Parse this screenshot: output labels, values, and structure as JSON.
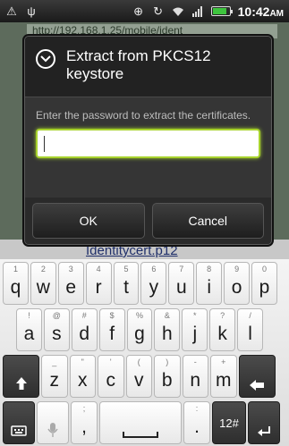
{
  "status_bar": {
    "time": "10:42",
    "ampm": "AM",
    "icons": [
      "warning-icon",
      "usb-icon",
      "gps-icon",
      "sync-icon",
      "wifi-icon",
      "signal-icon",
      "battery-icon"
    ],
    "battery_level": 0.85
  },
  "background": {
    "url": "http://192.168.1.25/mobile/ident",
    "file_link": "Identitycert.p12"
  },
  "dialog": {
    "title": "Extract from PKCS12 keystore",
    "message": "Enter the password to extract the certificates.",
    "password_value": "",
    "ok_label": "OK",
    "cancel_label": "Cancel"
  },
  "keyboard": {
    "row1": [
      {
        "key": "q",
        "sub": "1"
      },
      {
        "key": "w",
        "sub": "2"
      },
      {
        "key": "e",
        "sub": "3"
      },
      {
        "key": "r",
        "sub": "4"
      },
      {
        "key": "t",
        "sub": "5"
      },
      {
        "key": "y",
        "sub": "6"
      },
      {
        "key": "u",
        "sub": "7"
      },
      {
        "key": "i",
        "sub": "8"
      },
      {
        "key": "o",
        "sub": "9"
      },
      {
        "key": "p",
        "sub": "0"
      }
    ],
    "row2": [
      {
        "key": "a",
        "sub": "!"
      },
      {
        "key": "s",
        "sub": "@"
      },
      {
        "key": "d",
        "sub": "#"
      },
      {
        "key": "f",
        "sub": "$"
      },
      {
        "key": "g",
        "sub": "%"
      },
      {
        "key": "h",
        "sub": "&"
      },
      {
        "key": "j",
        "sub": "*"
      },
      {
        "key": "k",
        "sub": "?"
      },
      {
        "key": "l",
        "sub": "/"
      }
    ],
    "row3": [
      {
        "key": "z",
        "sub": "_"
      },
      {
        "key": "x",
        "sub": "\""
      },
      {
        "key": "c",
        "sub": "'"
      },
      {
        "key": "v",
        "sub": "("
      },
      {
        "key": "b",
        "sub": ")"
      },
      {
        "key": "n",
        "sub": "-"
      },
      {
        "key": "m",
        "sub": "+"
      }
    ],
    "comma": ",",
    "comma_sub": ";",
    "period": ".",
    "period_sub": ":",
    "sym_label": "12#"
  }
}
